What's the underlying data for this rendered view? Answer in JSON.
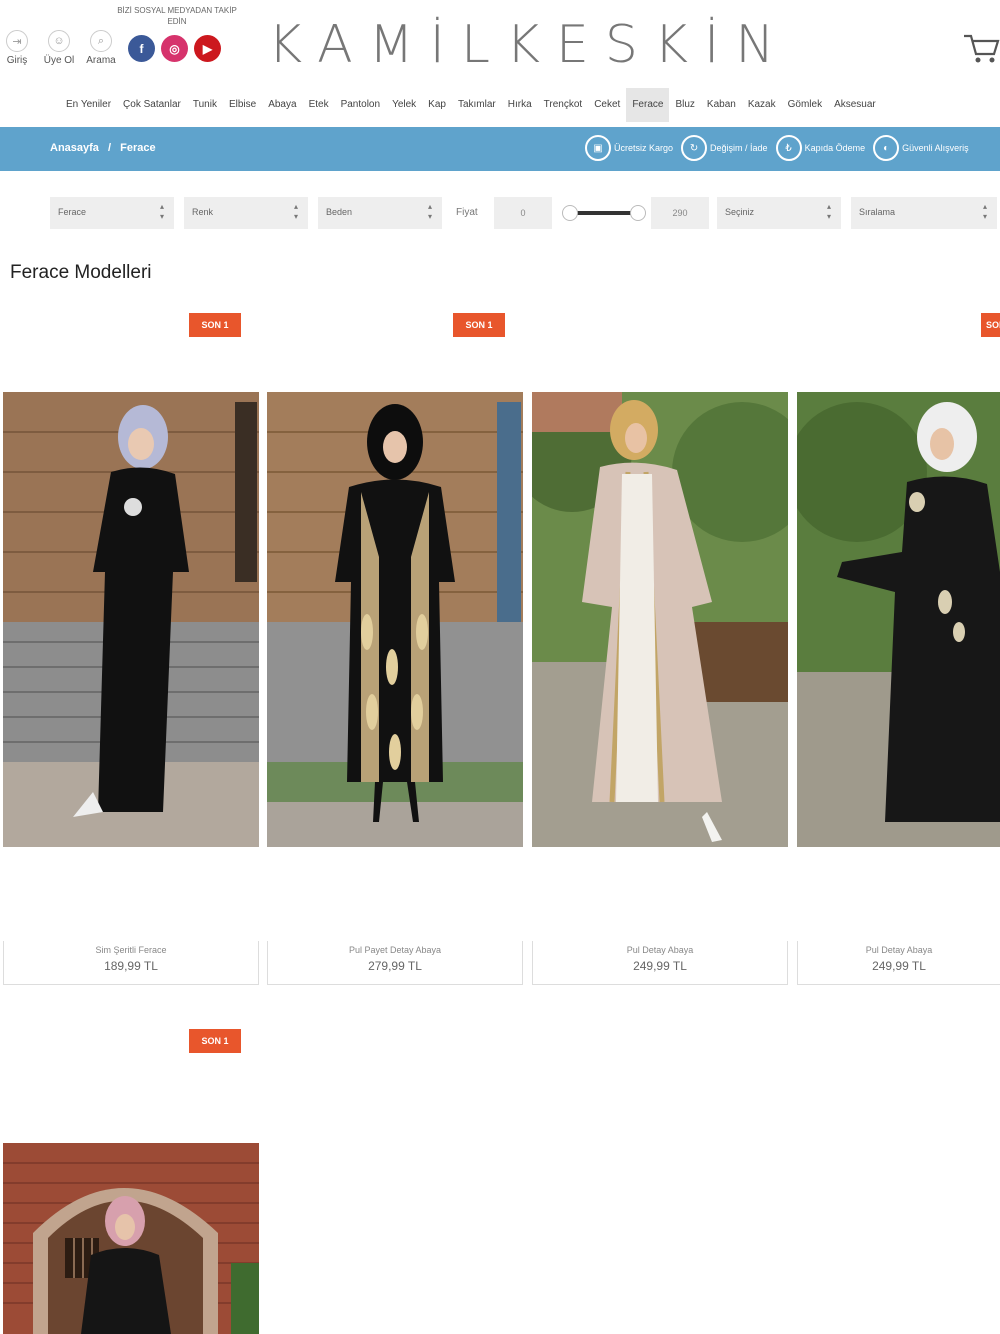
{
  "header": {
    "account_items": [
      {
        "label": "Giriş",
        "icon": "login-icon",
        "glyph": "⇥"
      },
      {
        "label": "Üye Ol",
        "icon": "user-plus-icon",
        "glyph": "☺"
      },
      {
        "label": "Arama",
        "icon": "search-icon",
        "glyph": "⌕"
      }
    ],
    "social_label": "BİZİ SOSYAL MEDYADAN TAKİP EDİN",
    "socials": [
      {
        "name": "facebook-icon",
        "glyph": "f",
        "color": "#3b5998"
      },
      {
        "name": "instagram-icon",
        "glyph": "◎",
        "color": "#d6336c"
      },
      {
        "name": "youtube-icon",
        "glyph": "▶",
        "color": "#cc181e"
      }
    ],
    "logo": "KAMİLKESKİN"
  },
  "nav": {
    "items": [
      "En Yeniler",
      "Çok Satanlar",
      "Tunik",
      "Elbise",
      "Abaya",
      "Etek",
      "Pantolon",
      "Yelek",
      "Kap",
      "Takımlar",
      "Hırka",
      "Trençkot",
      "Ceket",
      "Ferace",
      "Bluz",
      "Kaban",
      "Kazak",
      "Gömlek",
      "Aksesuar"
    ],
    "active": "Ferace"
  },
  "breadcrumb": {
    "home": "Anasayfa",
    "separator": "/",
    "current": "Ferace"
  },
  "features": [
    {
      "label": "Ücretsiz Kargo",
      "icon": "truck-icon",
      "glyph": "▣"
    },
    {
      "label": "Değişim / İade",
      "icon": "exchange-icon",
      "glyph": "↻"
    },
    {
      "label": "Kapıda Ödeme",
      "icon": "cash-icon",
      "glyph": "₺"
    },
    {
      "label": "Güvenli Alışveriş",
      "icon": "shield-icon",
      "glyph": "◐"
    }
  ],
  "filters": {
    "category": "Ferace",
    "color": "Renk",
    "size": "Beden",
    "price_label": "Fiyat",
    "price_min": "0",
    "price_max": "290",
    "price_range": [
      0,
      290
    ],
    "price_selected": [
      0,
      290
    ],
    "brand": "Seçiniz",
    "sort": "Sıralama"
  },
  "page_title": "Ferace Modelleri",
  "badge_text": "SON 1",
  "products": [
    {
      "name": "Sim Şeritli Ferace",
      "price": "189,99 TL"
    },
    {
      "name": "Pul Payet Detay Abaya",
      "price": "279,99 TL"
    },
    {
      "name": "Pul Detay Abaya",
      "price": "249,99 TL"
    },
    {
      "name": "Pul Detay Abaya",
      "price": "249,99 TL"
    },
    {
      "name": "",
      "price": ""
    }
  ],
  "colors": {
    "accent_bar": "#5fa3cc",
    "badge": "#e8562c"
  }
}
